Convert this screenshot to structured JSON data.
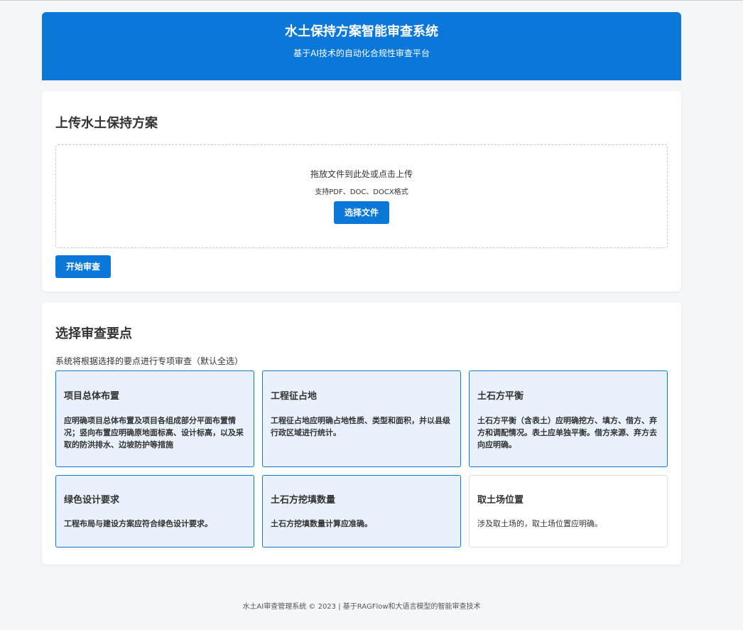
{
  "header": {
    "title": "水土保持方案智能审查系统",
    "subtitle": "基于AI技术的自动化合规性审查平台"
  },
  "upload": {
    "title": "上传水土保持方案",
    "drop_text": "拖放文件到此处或点击上传",
    "drop_hint": "支持PDF、DOC、DOCX格式",
    "choose_label": "选择文件",
    "start_label": "开始审查"
  },
  "points": {
    "title": "选择审查要点",
    "description": "系统将根据选择的要点进行专项审查（默认全选）",
    "items": [
      {
        "title": "项目总体布置",
        "desc": "应明确项目总体布置及项目各组成部分平面布置情况；竖向布置应明确原地面标高、设计标高，以及采取的防洪排水、边坡防护等措施",
        "selected": true
      },
      {
        "title": "工程征占地",
        "desc": "工程征占地应明确占地性质、类型和面积，并以县级行政区域进行统计。",
        "selected": true
      },
      {
        "title": "土石方平衡",
        "desc": "土石方平衡（含表土）应明确挖方、填方、借方、弃方和调配情况。表土应单独平衡。借方来源、弃方去向应明确。",
        "selected": true
      },
      {
        "title": "绿色设计要求",
        "desc": "工程布局与建设方案应符合绿色设计要求。",
        "selected": true
      },
      {
        "title": "土石方挖填数量",
        "desc": "土石方挖填数量计算应准确。",
        "selected": true
      },
      {
        "title": "取土场位置",
        "desc": "涉及取土场的，取土场位置应明确。",
        "selected": false
      }
    ]
  },
  "footer": {
    "text": "水土AI审查管理系统 © 2023 | 基于RAGFlow和大语言模型的智能审查技术"
  },
  "colors": {
    "primary": "#0b78d9",
    "selected_bg": "#e8f1fc",
    "page_bg": "#f4f6fa"
  }
}
